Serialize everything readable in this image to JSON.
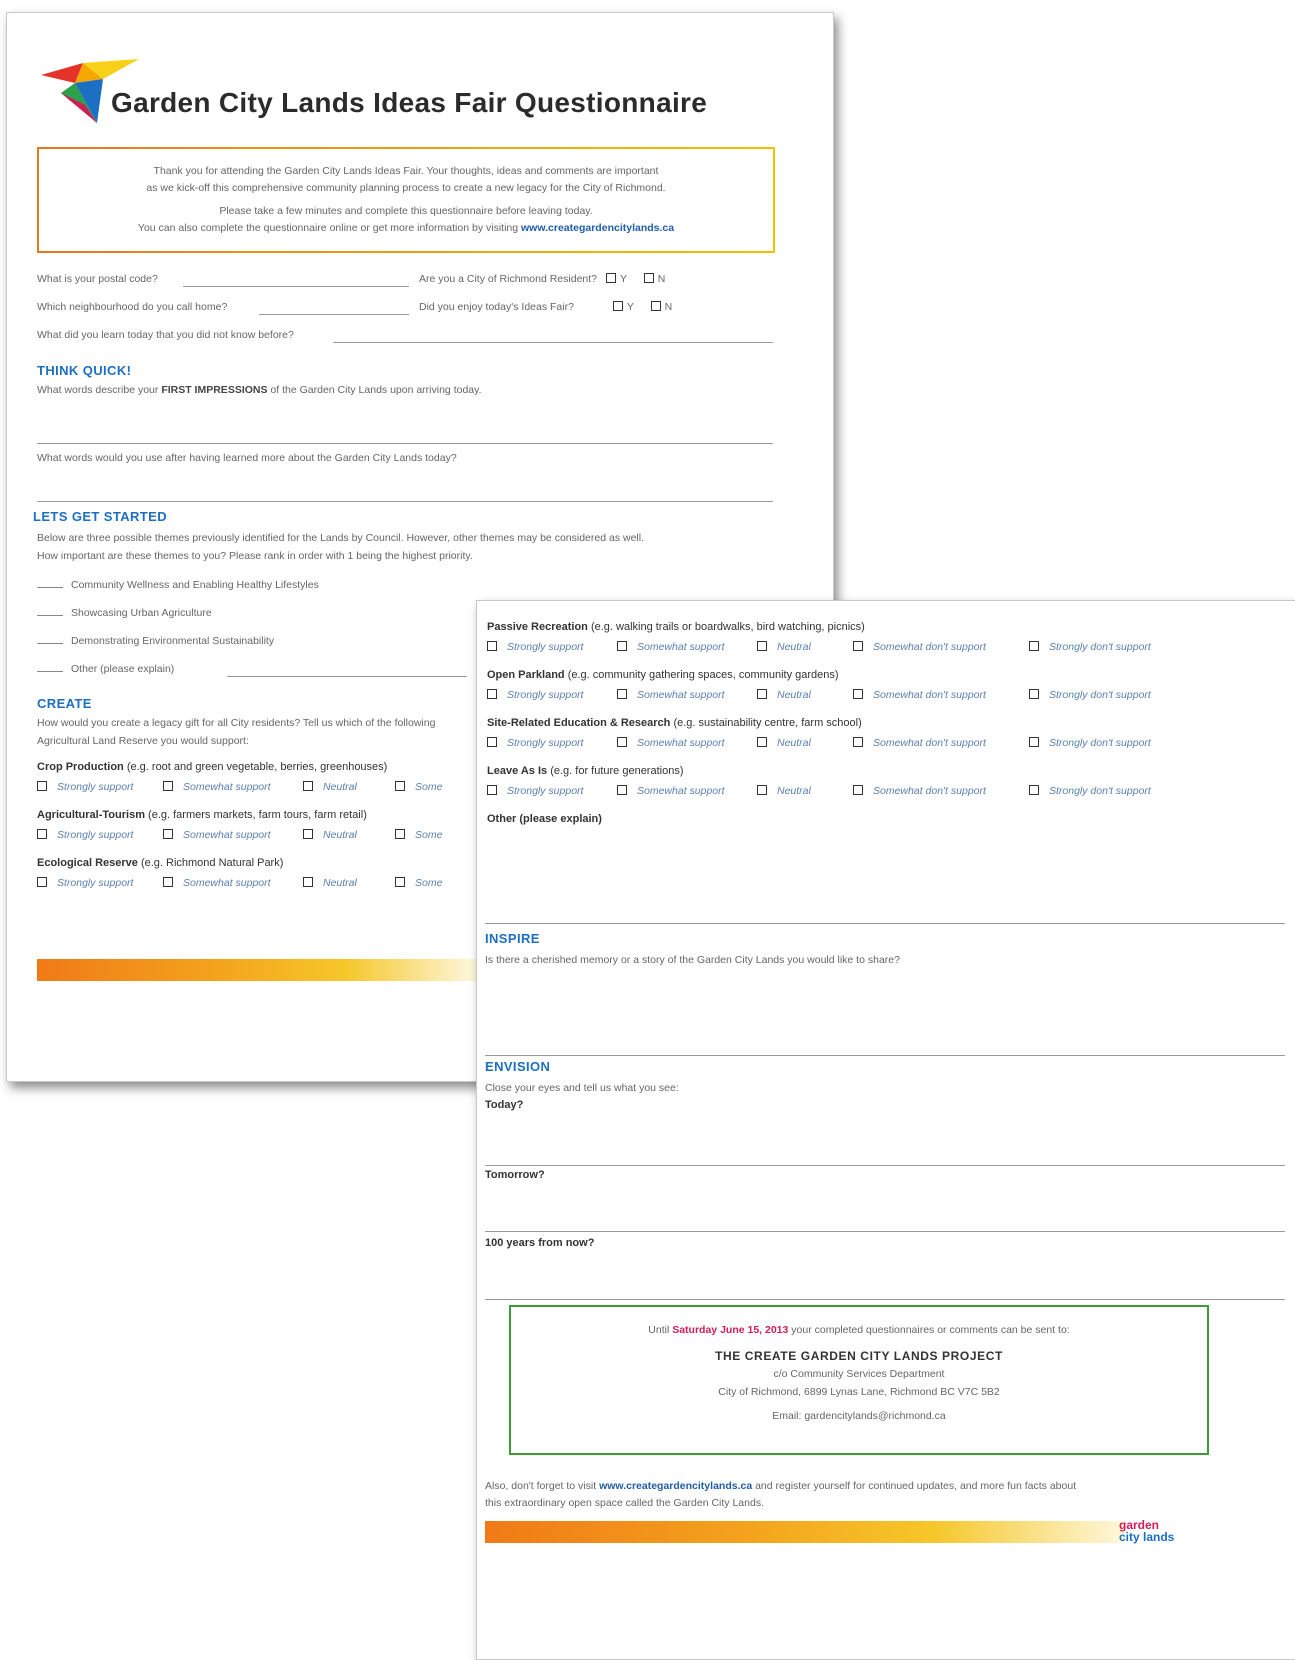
{
  "page1": {
    "title": "Garden City Lands Ideas Fair Questionnaire",
    "intro": {
      "line1": "Thank you for attending the Garden City Lands Ideas Fair. Your thoughts, ideas and comments are important",
      "line2": "as we kick-off this comprehensive community planning process to create a new legacy for the City of Richmond.",
      "line3": "Please take a few minutes and complete this questionnaire before leaving today.",
      "line4": "You can also complete the questionnaire online or get more information by visiting",
      "link": "www.creategardencitylands.ca"
    },
    "questions": {
      "postal": "What is your postal code?",
      "resident": "Are you a City of Richmond Resident?",
      "neighbourhood": "Which neighbourhood do you call home?",
      "enjoy": "Did you enjoy today's Ideas Fair?",
      "learn": "What did you learn today that you did not know before?",
      "yes": "Y",
      "no": "N"
    },
    "think_quick": {
      "heading": "THINK QUICK!",
      "q1_pre": "What words describe your ",
      "q1_bold": "FIRST IMPRESSIONS",
      "q1_post": " of the Garden City Lands upon arriving today.",
      "q2": "What words would you use after having learned more about the Garden City Lands today?"
    },
    "lets_get_started": {
      "heading": "LETS GET STARTED",
      "line1": "Below are three possible themes previously identified for the Lands by Council. However, other themes may be considered as well.",
      "line2": "How important are these themes to you? Please rank in order with 1 being the highest priority.",
      "items": [
        "Community Wellness and Enabling Healthy Lifestyles",
        "Showcasing Urban Agriculture",
        "Demonstrating Environmental Sustainability",
        "Other (please explain)"
      ]
    },
    "create": {
      "heading": "CREATE",
      "line1": "How would you create a legacy gift for all City residents? Tell us which of the following",
      "line2": "Agricultural Land Reserve you would support:",
      "themes": [
        {
          "bold": "Crop Production",
          "rest": " (e.g. root and green vegetable, berries, greenhouses)"
        },
        {
          "bold": "Agricultural-Tourism",
          "rest": " (e.g. farmers markets, farm tours, farm retail)"
        },
        {
          "bold": "Ecological Reserve",
          "rest": " (e.g. Richmond Natural Park)"
        }
      ],
      "options_visible": [
        "Strongly support",
        "Somewhat support",
        "Neutral",
        "Some"
      ]
    }
  },
  "page2": {
    "themes": [
      {
        "bold": "Passive Recreation",
        "rest": " (e.g. walking trails or boardwalks, bird watching, picnics)"
      },
      {
        "bold": "Open Parkland",
        "rest": " (e.g. community gathering spaces, community gardens)"
      },
      {
        "bold": "Site-Related Education & Research",
        "rest": " (e.g. sustainability centre, farm school)"
      },
      {
        "bold": "Leave As Is",
        "rest": " (e.g. for future generations)"
      }
    ],
    "options": [
      "Strongly support",
      "Somewhat support",
      "Neutral",
      "Somewhat don't support",
      "Strongly don't support"
    ],
    "other_label": "Other (please explain)",
    "inspire": {
      "heading": "INSPIRE",
      "question": "Is there a cherished memory or a story of the Garden City Lands you would like to share?"
    },
    "envision": {
      "heading": "ENVISION",
      "prompt": "Close your eyes and tell us what you see:",
      "today": "Today?",
      "tomorrow": "Tomorrow?",
      "hundred": "100 years from now?"
    },
    "contact": {
      "until_pre": "Until",
      "date": "Saturday June 15, 2013",
      "until_post": "your completed questionnaires or comments can be sent to:",
      "project": "THE CREATE GARDEN CITY LANDS PROJECT",
      "dept": "c/o Community Services Department",
      "address": "City of Richmond, 6899 Lynas Lane, Richmond BC V7C 5B2",
      "email": "Email: gardencitylands@richmond.ca"
    },
    "footer": {
      "pre": "Also, don't forget to visit",
      "link": "www.creategardencitylands.ca",
      "post": "and register yourself for continued updates, and more fun facts about",
      "line2": "this extraordinary open space called the Garden City Lands."
    },
    "logo": {
      "line1": "garden",
      "line2": "city lands"
    }
  }
}
